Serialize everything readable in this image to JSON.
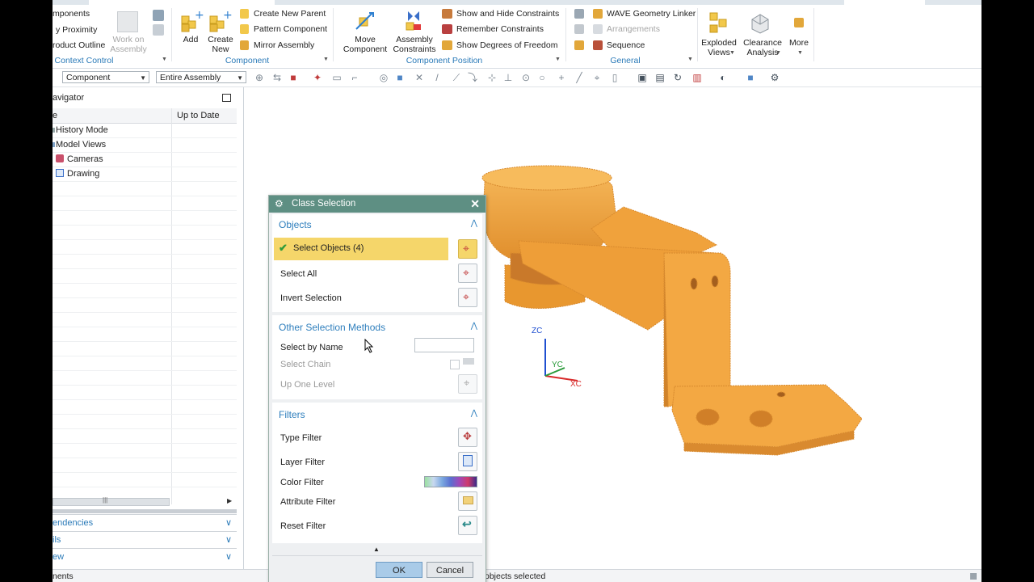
{
  "ribbon": {
    "context_control": {
      "items": [
        "mponents",
        "y Proximity",
        "roduct Outline"
      ],
      "work_on_assembly": "Work on\nAssembly",
      "group_label": "Context Control"
    },
    "component": {
      "add_label": "Add",
      "create_new_label": "Create\nNew",
      "create_new_parent": "Create New Parent",
      "pattern_component": "Pattern Component",
      "mirror_assembly": "Mirror Assembly",
      "group_label": "Component"
    },
    "component_position": {
      "move_component": "Move\nComponent",
      "assembly_constraints": "Assembly\nConstraints",
      "show_hide_constraints": "Show and Hide Constraints",
      "remember_constraints": "Remember Constraints",
      "show_dof": "Show Degrees of Freedom",
      "group_label": "Component Position"
    },
    "general": {
      "wave_linker": "WAVE Geometry Linker",
      "arrangements": "Arrangements",
      "sequence": "Sequence",
      "group_label": "General"
    },
    "exploded_views": "Exploded\nViews",
    "clearance_analysis": "Clearance\nAnalysis",
    "more": "More"
  },
  "toolbar": {
    "filter_value": "Component",
    "scope_value": "Entire Assembly"
  },
  "navigator": {
    "title": "avigator",
    "col_name": "e",
    "col_uptodate": "Up to Date",
    "rows": [
      "History Mode",
      "Model Views",
      "Cameras",
      "Drawing"
    ],
    "collapsed": [
      "endencies",
      "ils",
      "ew"
    ]
  },
  "dialog": {
    "title": "Class Selection",
    "objects_header": "Objects",
    "select_objects": "Select Objects (4)",
    "select_all": "Select All",
    "invert_selection": "Invert Selection",
    "other_header": "Other Selection Methods",
    "select_by_name": "Select by Name",
    "select_by_name_value": "",
    "select_chain": "Select Chain",
    "up_one_level": "Up One Level",
    "filters_header": "Filters",
    "type_filter": "Type Filter",
    "layer_filter": "Layer Filter",
    "color_filter": "Color Filter",
    "attribute_filter": "Attribute Filter",
    "reset_filter": "Reset Filter",
    "ok": "OK",
    "cancel": "Cancel"
  },
  "axes": {
    "zc": "ZC",
    "yc": "YC",
    "xc": "XC"
  },
  "status": {
    "left": "nents",
    "right": "objects selected"
  },
  "colors": {
    "model": "#f0a23c",
    "dialog_title": "#5e8f83",
    "section_header": "#2f7fbd",
    "selected_row": "#f5d66a"
  }
}
